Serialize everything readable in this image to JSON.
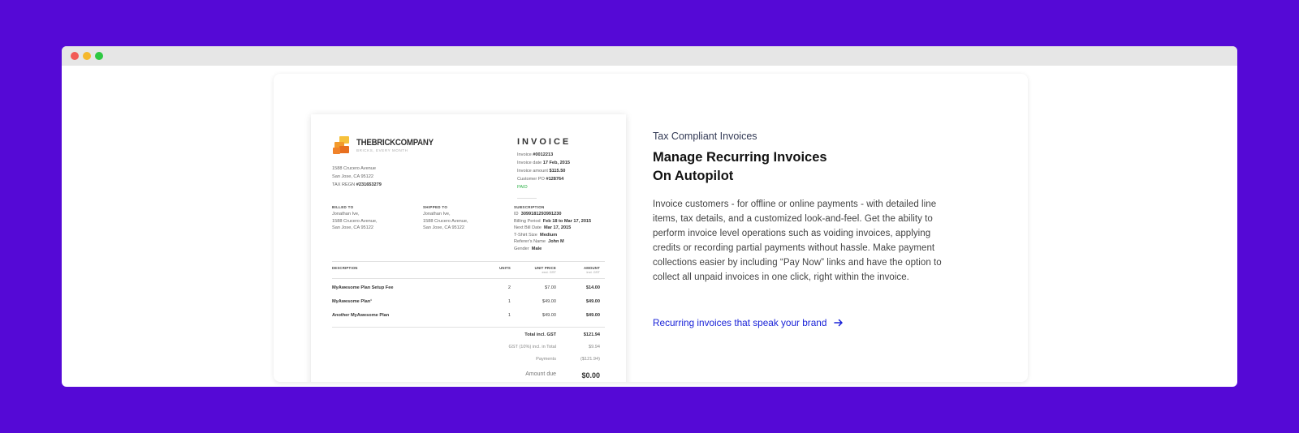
{
  "colors": {
    "background": "#5509d6",
    "link": "#1a23d8",
    "paid": "#2fb24a"
  },
  "window": {
    "controls": [
      "close-dot",
      "minimize-dot",
      "maximize-dot"
    ]
  },
  "invoice": {
    "logo_name": "THEBRICKCOMPANY",
    "logo_tagline": "BRICKS, EVERY MONTH",
    "from_address": [
      "1588 Crucero Avenue",
      "San Jose, CA 95122"
    ],
    "tax_label": "TAX REGN",
    "tax_value": "#231653279",
    "title": "INVOICE",
    "meta": [
      {
        "label": "Invoice",
        "value": "#0012213"
      },
      {
        "label": "Invoice date",
        "value": "17 Feb, 2015"
      },
      {
        "label": "Invoice amount",
        "value": "$115.50"
      },
      {
        "label": "Customer PO",
        "value": "#128764"
      }
    ],
    "status": "PAID",
    "billed_to": {
      "heading": "BILLED TO",
      "lines": [
        "Jonathan Ive,",
        "1588 Crucero Avenue,",
        "San Jose, CA 95122"
      ]
    },
    "shipped_to": {
      "heading": "SHIPPED TO",
      "lines": [
        "Jonathan Ive,",
        "1588 Crucero Avenue,",
        "San Jose, CA 95122"
      ]
    },
    "subscription": {
      "heading": "SUBSCRIPTION",
      "rows": [
        {
          "label": "ID",
          "value": "3099181293991230"
        },
        {
          "label": "Billing Period",
          "value": "Feb 18 to Mar 17, 2015"
        },
        {
          "label": "Next Bill Date",
          "value": "Mar 17, 2015"
        },
        {
          "label": "T-Shirt Size",
          "value": "Medium"
        },
        {
          "label": "Referer's Name",
          "value": "John M"
        },
        {
          "label": "Gender",
          "value": "Male"
        }
      ]
    },
    "table": {
      "col_description": "DESCRIPTION",
      "col_units": "UNITS",
      "col_unit_price": "UNIT PRICE",
      "col_unit_price_sub": "excl. GST",
      "col_amount": "AMOUNT",
      "col_amount_sub": "incl. GST",
      "rows": [
        {
          "description": "MyAwesome Plan Setup Fee",
          "units": "2",
          "unit_price": "$7.00",
          "amount": "$14.00"
        },
        {
          "description": "MyAwesome Plan¹",
          "units": "1",
          "unit_price": "$49.00",
          "amount": "$49.00"
        },
        {
          "description": "Another MyAwesome Plan",
          "units": "1",
          "unit_price": "$49.00",
          "amount": "$49.00"
        }
      ]
    },
    "totals": [
      {
        "label": "Total incl. GST",
        "value": "$121.94"
      },
      {
        "label": "GST (10%) incl. in Total",
        "value": "$9.94"
      },
      {
        "label": "Payments",
        "value": "($121.94)"
      }
    ],
    "amount_due": {
      "label": "Amount due",
      "value": "$0.00"
    }
  },
  "feature": {
    "kicker": "Tax Compliant Invoices",
    "headline_line1": "Manage Recurring Invoices",
    "headline_line2": "On Autopilot",
    "description": "Invoice customers - for offline or online payments - with detailed line items, tax details, and a customized look-and-feel. Get the ability to perform invoice level operations such as voiding invoices, applying credits or recording partial payments without hassle. Make payment collections easier by including “Pay Now” links and have the option to collect all unpaid invoices in one click, right within the invoice.",
    "cta_label": "Recurring invoices that speak your brand",
    "cta_icon": "arrow-right-icon"
  }
}
